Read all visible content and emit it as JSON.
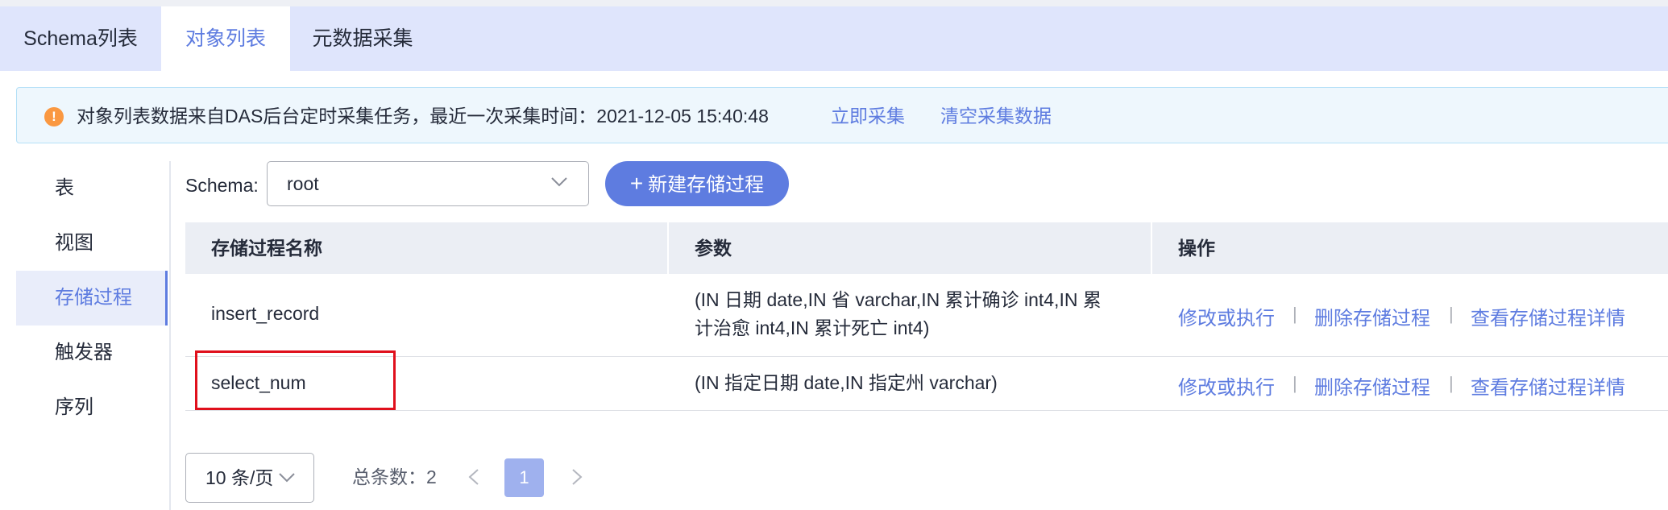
{
  "tabs": [
    {
      "label": "Schema列表",
      "active": false
    },
    {
      "label": "对象列表",
      "active": true
    },
    {
      "label": "元数据采集",
      "active": false
    }
  ],
  "alert": {
    "icon": "info-icon",
    "icon_glyph": "!",
    "message": "对象列表数据来自DAS后台定时采集任务，最近一次采集时间：2021-12-05 15:40:48",
    "collect_now": "立即采集",
    "clear_data": "清空采集数据"
  },
  "sidebar": {
    "items": [
      {
        "label": "表",
        "active": false
      },
      {
        "label": "视图",
        "active": false
      },
      {
        "label": "存储过程",
        "active": true
      },
      {
        "label": "触发器",
        "active": false
      },
      {
        "label": "序列",
        "active": false
      }
    ]
  },
  "toolbar": {
    "schema_label": "Schema:",
    "schema_value": "root",
    "new_button": "新建存储过程",
    "plus_glyph": "+"
  },
  "table": {
    "headers": [
      "存储过程名称",
      "参数",
      "操作"
    ],
    "rows": [
      {
        "name": "insert_record",
        "params_line1": "(IN 日期 date,IN 省 varchar,IN 累计确诊 int4,IN 累",
        "params_line2": "计治愈 int4,IN 累计死亡 int4)",
        "actions": [
          "修改或执行",
          "删除存储过程",
          "查看存储过程详情"
        ]
      },
      {
        "name": "select_num",
        "params_line1": "(IN 指定日期 date,IN 指定州 varchar)",
        "params_line2": "",
        "actions": [
          "修改或执行",
          "删除存储过程",
          "查看存储过程详情"
        ]
      }
    ],
    "action_separator": "|"
  },
  "pagination": {
    "page_size": "10 条/页",
    "total_label": "总条数：2",
    "current_page": "1"
  },
  "colors": {
    "accent": "#5e7ce0",
    "tab_bar": "#dfe5fc",
    "alert_bg": "#eef7fd",
    "alert_icon": "#fa9841",
    "highlight_box": "#e0101c"
  }
}
